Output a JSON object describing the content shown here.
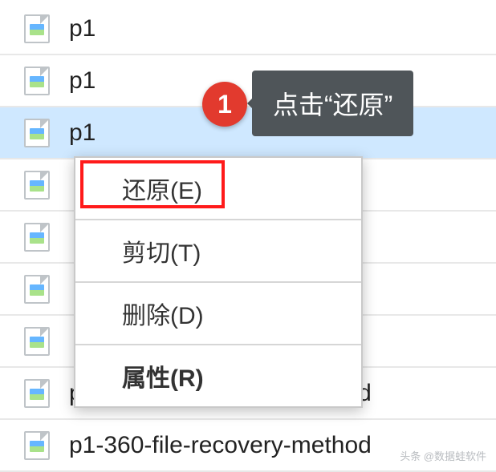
{
  "files": [
    {
      "name": "p1",
      "selected": false
    },
    {
      "name": "p1",
      "selected": false
    },
    {
      "name": "p1",
      "selected": true
    },
    {
      "name": "",
      "selected": false
    },
    {
      "name": "",
      "selected": false
    },
    {
      "name": "",
      "selected": false
    },
    {
      "name": "",
      "selected": false
    },
    {
      "name": "p1-360-file-recovery-method",
      "selected": false
    },
    {
      "name": "p1-360-file-recovery-method",
      "selected": false
    }
  ],
  "context_menu": {
    "items": [
      {
        "label": "还原(E)",
        "hotkey": "E",
        "highlighted": true
      },
      {
        "label": "剪切(T)",
        "hotkey": "T",
        "highlighted": false
      },
      {
        "label": "删除(D)",
        "hotkey": "D",
        "highlighted": false
      },
      {
        "label": "属性(R)",
        "hotkey": "R",
        "highlighted": false
      }
    ]
  },
  "annotation": {
    "badge_number": "1",
    "tooltip_text": "点击“还原”"
  },
  "watermark": "头条 @数据蛙软件"
}
